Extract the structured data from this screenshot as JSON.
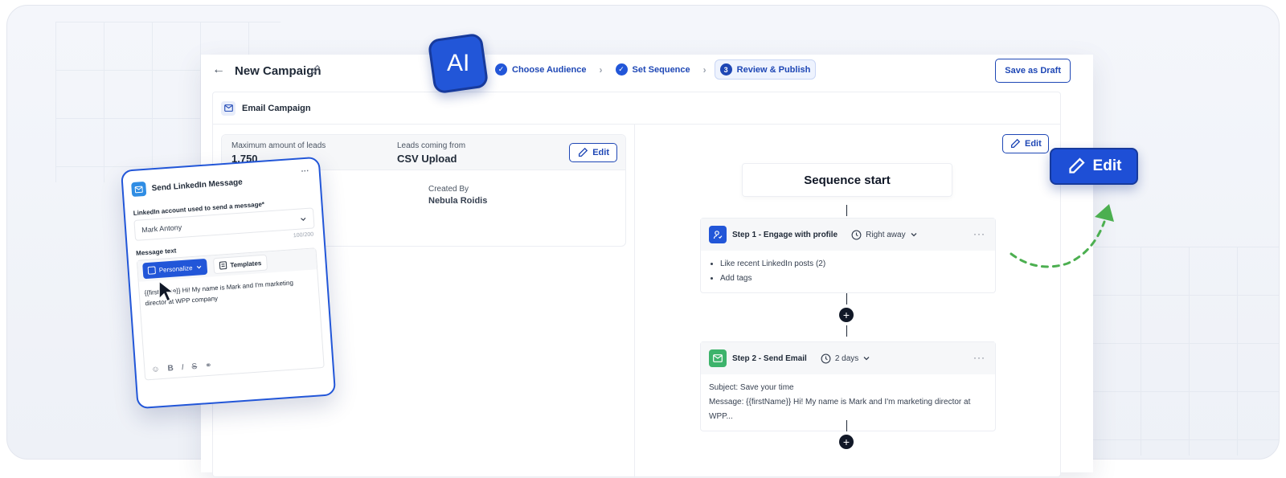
{
  "topbar": {
    "back_icon": "arrow-left-icon",
    "campaign_title": "New Campaign",
    "steps": [
      {
        "label": "Choose Audience",
        "state": "done"
      },
      {
        "label": "Set Sequence",
        "state": "done"
      },
      {
        "label": "Review & Publish",
        "state": "active",
        "number": "3"
      }
    ],
    "save_draft_label": "Save as Draft"
  },
  "ai_badge": "AI",
  "panel": {
    "title": "Email Campaign",
    "leads": {
      "max_label": "Maximum amount of leads",
      "max_value": "1,750",
      "source_label": "Leads coming from",
      "source_value": "CSV Upload",
      "edit_label": "Edit",
      "created_by_label": "Created By",
      "created_by_value": "Nebula Roidis"
    }
  },
  "sequence": {
    "edit_label": "Edit",
    "start_label": "Sequence start",
    "steps": [
      {
        "title": "Step 1 - Engage with profile",
        "timing": "Right away",
        "items": [
          "Like recent LinkedIn posts (2)",
          "Add tags"
        ]
      },
      {
        "title": "Step 2 - Send Email",
        "timing": "2 days",
        "subject": "Subject: Save your time",
        "message": "Message: {{firstName}} Hi! My name is Mark and I'm marketing director at WPP..."
      }
    ]
  },
  "big_edit_label": "Edit",
  "linkedin_card": {
    "title": "Send LinkedIn Message",
    "account_label": "LinkedIn account used to send a message*",
    "account_value": "Mark Antony",
    "counter": "100/200",
    "message_label": "Message text",
    "personalize_label": "Personalize",
    "templates_label": "Templates",
    "message_text": "{{firstName}} Hi! My name is Mark and I'm marketing director at WPP company"
  },
  "colors": {
    "primary": "#2256d8",
    "primary_dark": "#1e47b5",
    "green": "#3db36b",
    "dashed_arrow": "#4caf50"
  }
}
